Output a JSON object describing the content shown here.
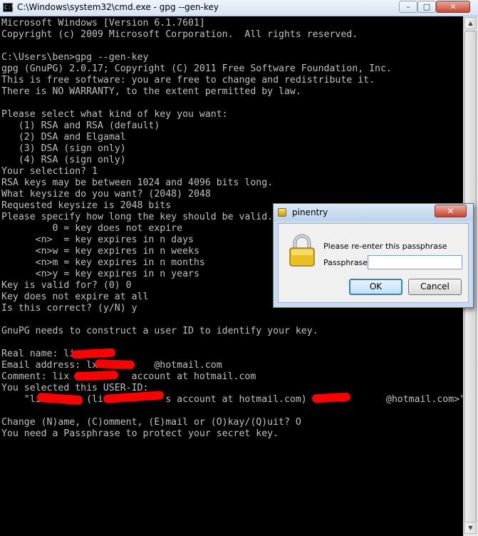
{
  "window": {
    "title": "C:\\Windows\\system32\\cmd.exe - gpg  --gen-key",
    "icon": "cmd-icon",
    "controls": {
      "minimize": "–",
      "maximize": "□",
      "close": "✕"
    }
  },
  "console": {
    "text": "Microsoft Windows [Version 6.1.7601]\nCopyright (c) 2009 Microsoft Corporation.  All rights reserved.\n\nC:\\Users\\ben>gpg --gen-key\ngpg (GnuPG) 2.0.17; Copyright (C) 2011 Free Software Foundation, Inc.\nThis is free software: you are free to change and redistribute it.\nThere is NO WARRANTY, to the extent permitted by law.\n\nPlease select what kind of key you want:\n   (1) RSA and RSA (default)\n   (2) DSA and Elgamal\n   (3) DSA (sign only)\n   (4) RSA (sign only)\nYour selection? 1\nRSA keys may be between 1024 and 4096 bits long.\nWhat keysize do you want? (2048) 2048\nRequested keysize is 2048 bits\nPlease specify how long the key should be valid.\n         0 = key does not expire\n      <n>  = key expires in n days\n      <n>w = key expires in n weeks\n      <n>m = key expires in n months\n      <n>y = key expires in n years\nKey is valid for? (0) 0\nKey does not expire at all\nIs this correct? (y/N) y\n\nGnuPG needs to construct a user ID to identify your key.\n\nReal name: li\nEmail address: lx          @hotmail.com\nComment: lix           account at hotmail.com\nYou selected this USER-ID:\n    \"li        (li          's account at hotmail.com) <lx          @hotmail.com>\"\n\nChange (N)ame, (C)omment, (E)mail or (O)kay/(Q)uit? O\nYou need a Passphrase to protect your secret key."
  },
  "dialog": {
    "title": "pinentry",
    "close": "✕",
    "message": "Please re-enter this passphrase",
    "passphrase_label": "Passphrase",
    "passphrase_value": "",
    "ok_label": "OK",
    "cancel_label": "Cancel",
    "icon": "padlock-icon"
  },
  "colors": {
    "console_bg": "#000000",
    "console_text": "#c0c0c0",
    "redaction": "#ff0000"
  }
}
